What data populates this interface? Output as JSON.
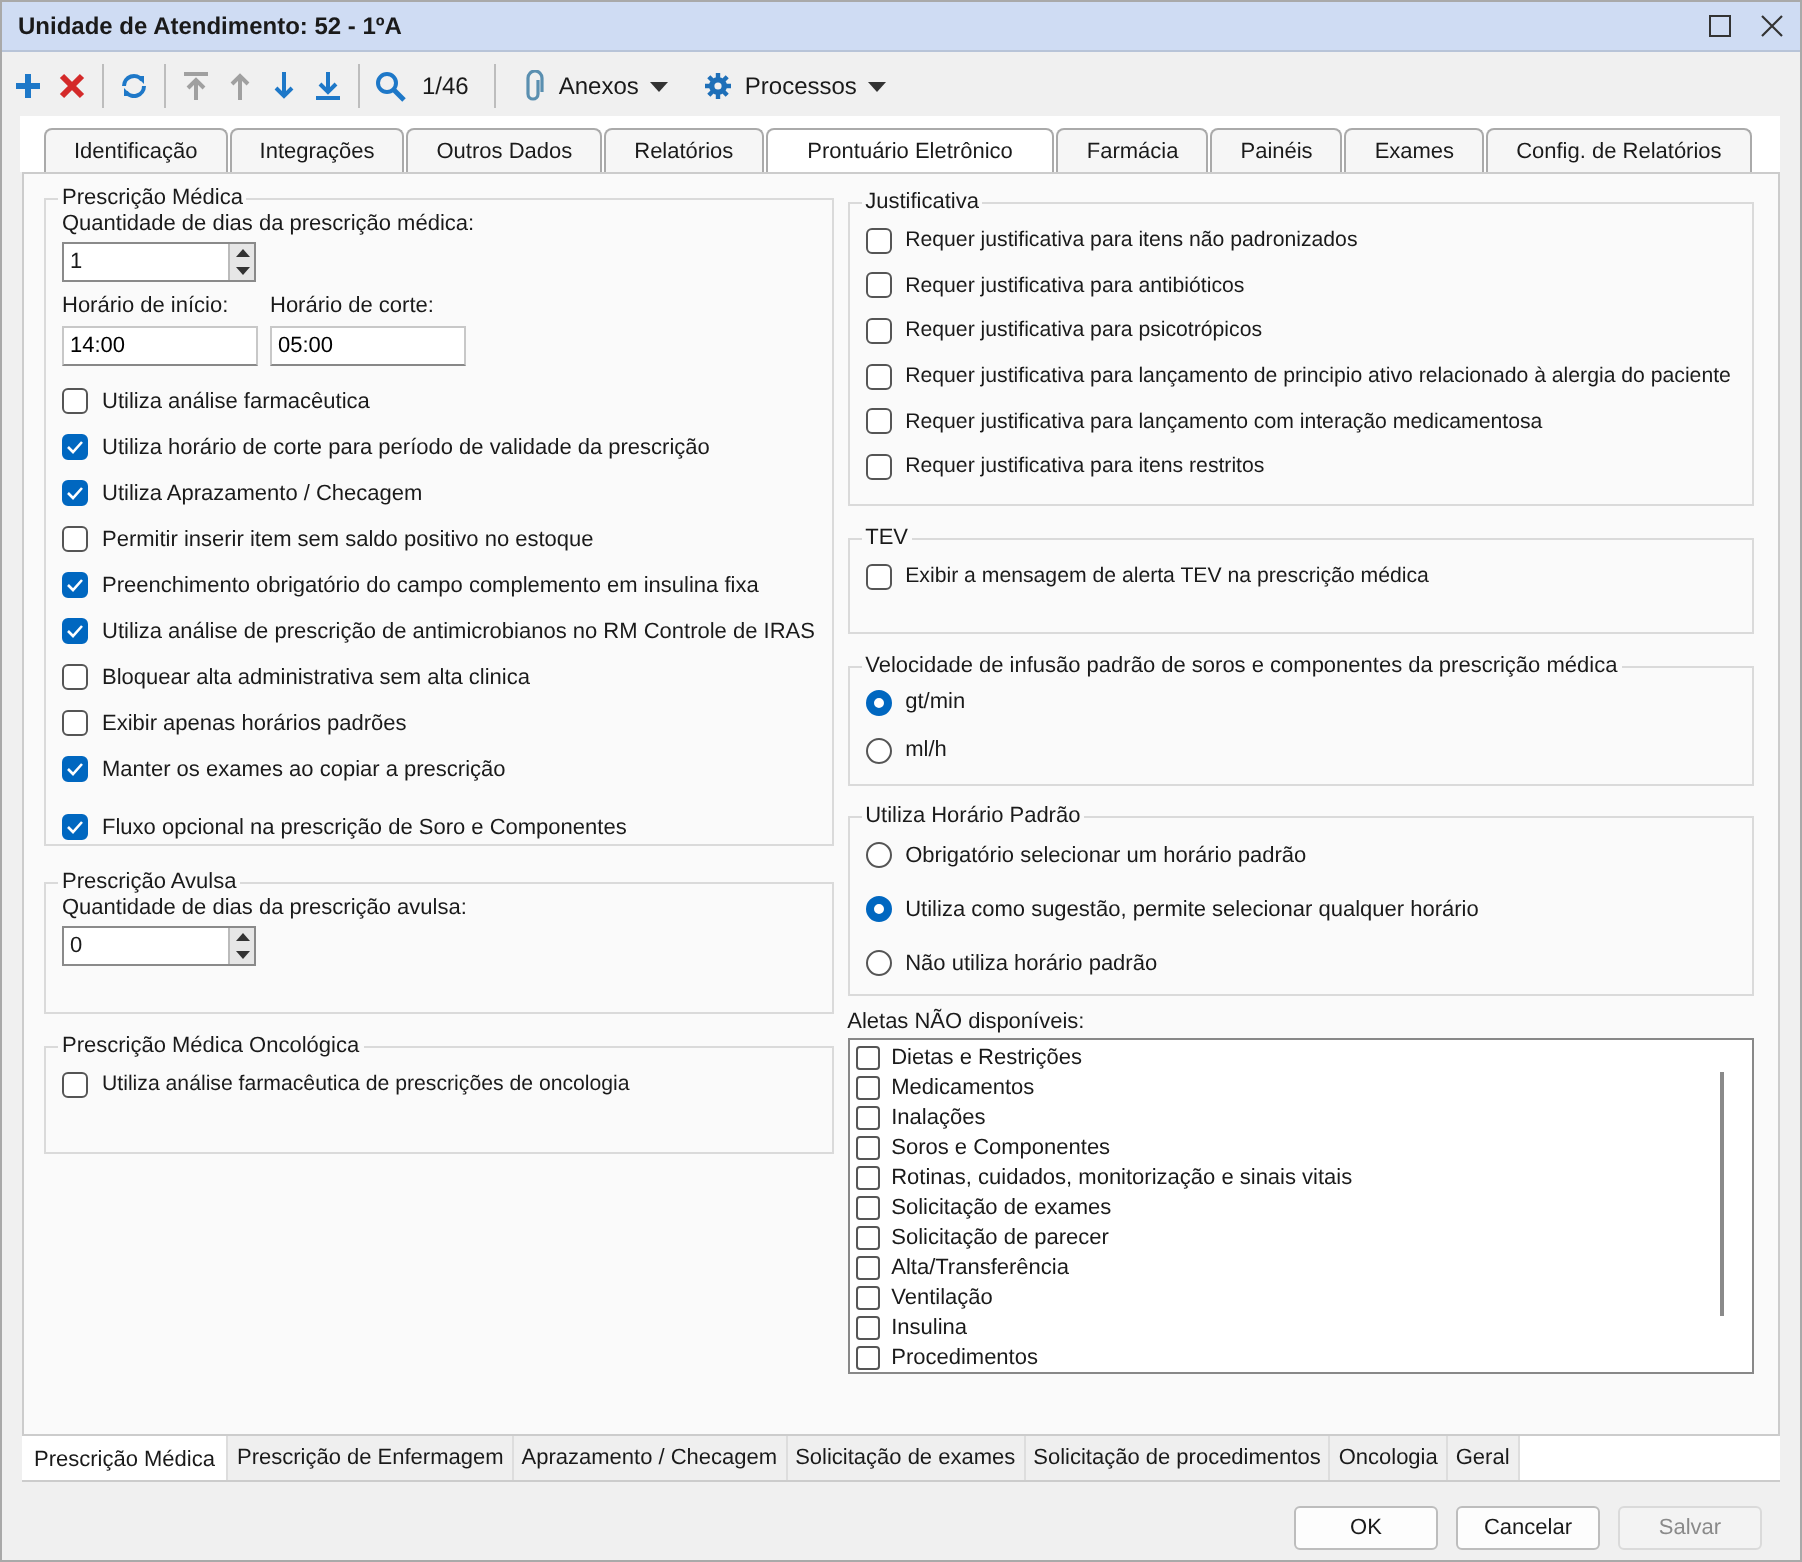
{
  "window": {
    "title": "Unidade de Atendimento: 52 - 1ºA"
  },
  "toolbar": {
    "buttons": [
      {
        "disabled": false
      },
      {
        "disabled": false
      },
      {
        "disabled": false
      },
      {
        "disabled": true
      },
      {
        "disabled": true
      },
      {
        "disabled": false
      },
      {
        "disabled": false
      },
      {
        "disabled": false
      }
    ],
    "counter": "1/46",
    "menus": [
      {
        "label": "Anexos"
      },
      {
        "label": "Processos"
      }
    ]
  },
  "tabs": [
    {
      "label": "Identificação",
      "selected": false
    },
    {
      "label": "Integrações",
      "selected": false
    },
    {
      "label": "Outros Dados",
      "selected": false
    },
    {
      "label": "Relatórios",
      "selected": false
    },
    {
      "label": "Prontuário Eletrônico",
      "selected": true
    },
    {
      "label": "Farmácia",
      "selected": false
    },
    {
      "label": "Painéis",
      "selected": false
    },
    {
      "label": "Exames",
      "selected": false
    },
    {
      "label": "Config. de Relatórios",
      "selected": false
    }
  ],
  "prescricao_medica": {
    "title": "Prescrição Médica",
    "days_label": "Quantidade de dias da prescrição médica:",
    "days_value": "1",
    "start_label": "Horário de início:",
    "start_value": "14:00",
    "cut_label": "Horário de corte:",
    "cut_value": "05:00",
    "options": [
      {
        "label": "Utiliza análise farmacêutica",
        "checked": false
      },
      {
        "label": "Utiliza horário de corte para período de validade da prescrição",
        "checked": true
      },
      {
        "label": "Utiliza Aprazamento / Checagem",
        "checked": true
      },
      {
        "label": "Permitir inserir item sem saldo positivo no estoque",
        "checked": false
      },
      {
        "label": "Preenchimento obrigatório do campo complemento em insulina fixa",
        "checked": true
      },
      {
        "label": "Utiliza análise de prescrição de antimicrobianos no RM Controle de IRAS",
        "checked": true
      },
      {
        "label": "Bloquear alta administrativa sem alta clinica",
        "checked": false
      },
      {
        "label": "Exibir apenas horários padrões",
        "checked": false
      },
      {
        "label": "Manter os exames ao copiar a prescrição",
        "checked": true
      },
      {
        "label": "Fluxo opcional na prescrição de Soro e Componentes",
        "checked": true
      }
    ]
  },
  "prescricao_avulsa": {
    "title": "Prescrição Avulsa",
    "days_label": "Quantidade de dias da prescrição avulsa:",
    "days_value": "0"
  },
  "oncologica": {
    "title": "Prescrição Médica Oncológica",
    "options": [
      {
        "label": "Utiliza análise farmacêutica de prescrições de oncologia",
        "checked": false
      }
    ]
  },
  "justificativa": {
    "title": "Justificativa",
    "options": [
      {
        "label": "Requer justificativa para itens não padronizados",
        "checked": false
      },
      {
        "label": "Requer justificativa para antibióticos",
        "checked": false
      },
      {
        "label": "Requer justificativa para psicotrópicos",
        "checked": false
      },
      {
        "label": "Requer justificativa para lançamento de principio ativo relacionado à alergia do paciente",
        "checked": false
      },
      {
        "label": "Requer justificativa para lançamento com interação medicamentosa",
        "checked": false
      },
      {
        "label": "Requer justificativa para itens restritos",
        "checked": false
      }
    ]
  },
  "tev": {
    "title": "TEV",
    "options": [
      {
        "label": "Exibir a mensagem de alerta TEV na prescrição médica",
        "checked": false
      }
    ]
  },
  "velocidade": {
    "title": "Velocidade de infusão padrão de soros e componentes da prescrição médica",
    "options": [
      {
        "label": "gt/min",
        "selected": true
      },
      {
        "label": "ml/h",
        "selected": false
      }
    ]
  },
  "horario_padrao": {
    "title": "Utiliza Horário Padrão",
    "options": [
      {
        "label": "Obrigatório selecionar um horário padrão",
        "selected": false
      },
      {
        "label": "Utiliza como sugestão, permite selecionar qualquer horário",
        "selected": true
      },
      {
        "label": "Não utiliza horário padrão",
        "selected": false
      }
    ]
  },
  "alerts": {
    "label": "Aletas NÃO disponíveis:",
    "items": [
      {
        "label": "Dietas e Restrições",
        "checked": false
      },
      {
        "label": "Medicamentos",
        "checked": false
      },
      {
        "label": "Inalações",
        "checked": false
      },
      {
        "label": "Soros e Componentes",
        "checked": false
      },
      {
        "label": "Rotinas, cuidados, monitorização e sinais vitais",
        "checked": false
      },
      {
        "label": "Solicitação de exames",
        "checked": false
      },
      {
        "label": "Solicitação de parecer",
        "checked": false
      },
      {
        "label": "Alta/Transferência",
        "checked": false
      },
      {
        "label": "Ventilação",
        "checked": false
      },
      {
        "label": "Insulina",
        "checked": false
      },
      {
        "label": "Procedimentos",
        "checked": false
      }
    ]
  },
  "bottom_tabs": [
    {
      "label": "Prescrição Médica",
      "selected": true
    },
    {
      "label": "Prescrição de Enfermagem",
      "selected": false
    },
    {
      "label": "Aprazamento / Checagem",
      "selected": false
    },
    {
      "label": "Solicitação de exames",
      "selected": false
    },
    {
      "label": "Solicitação de procedimentos",
      "selected": false
    },
    {
      "label": "Oncologia",
      "selected": false
    },
    {
      "label": "Geral",
      "selected": false
    }
  ],
  "buttons": [
    {
      "label": "OK",
      "disabled": false
    },
    {
      "label": "Cancelar",
      "disabled": false
    },
    {
      "label": "Salvar",
      "disabled": true
    }
  ]
}
